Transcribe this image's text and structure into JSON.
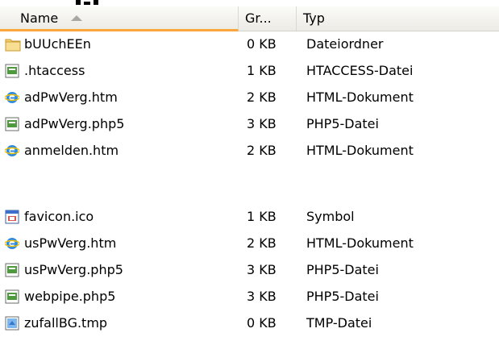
{
  "header": {
    "name": "Name",
    "size": "Gr...",
    "type": "Typ"
  },
  "files": [
    {
      "name": "bUUchEEn",
      "size": "0 KB",
      "type": "Dateiordner",
      "icon": "folder-icon"
    },
    {
      "name": ".htaccess",
      "size": "1 KB",
      "type": "HTACCESS-Datei",
      "icon": "generic-file-icon"
    },
    {
      "name": "adPwVerg.htm",
      "size": "2 KB",
      "type": "HTML-Dokument",
      "icon": "ie-html-icon"
    },
    {
      "name": "adPwVerg.php5",
      "size": "3 KB",
      "type": "PHP5-Datei",
      "icon": "generic-file-icon"
    },
    {
      "name": "anmelden.htm",
      "size": "2 KB",
      "type": "HTML-Dokument",
      "icon": "ie-html-icon"
    },
    {
      "name": "favicon.ico",
      "size": "1 KB",
      "type": "Symbol",
      "icon": "ico-file-icon"
    },
    {
      "name": "usPwVerg.htm",
      "size": "2 KB",
      "type": "HTML-Dokument",
      "icon": "ie-html-icon"
    },
    {
      "name": "usPwVerg.php5",
      "size": "3 KB",
      "type": "PHP5-Datei",
      "icon": "generic-file-icon"
    },
    {
      "name": "webpipe.php5",
      "size": "3 KB",
      "type": "PHP5-Datei",
      "icon": "generic-file-icon"
    },
    {
      "name": "zufallBG.tmp",
      "size": "0 KB",
      "type": "TMP-Datei",
      "icon": "tmp-file-icon"
    }
  ]
}
